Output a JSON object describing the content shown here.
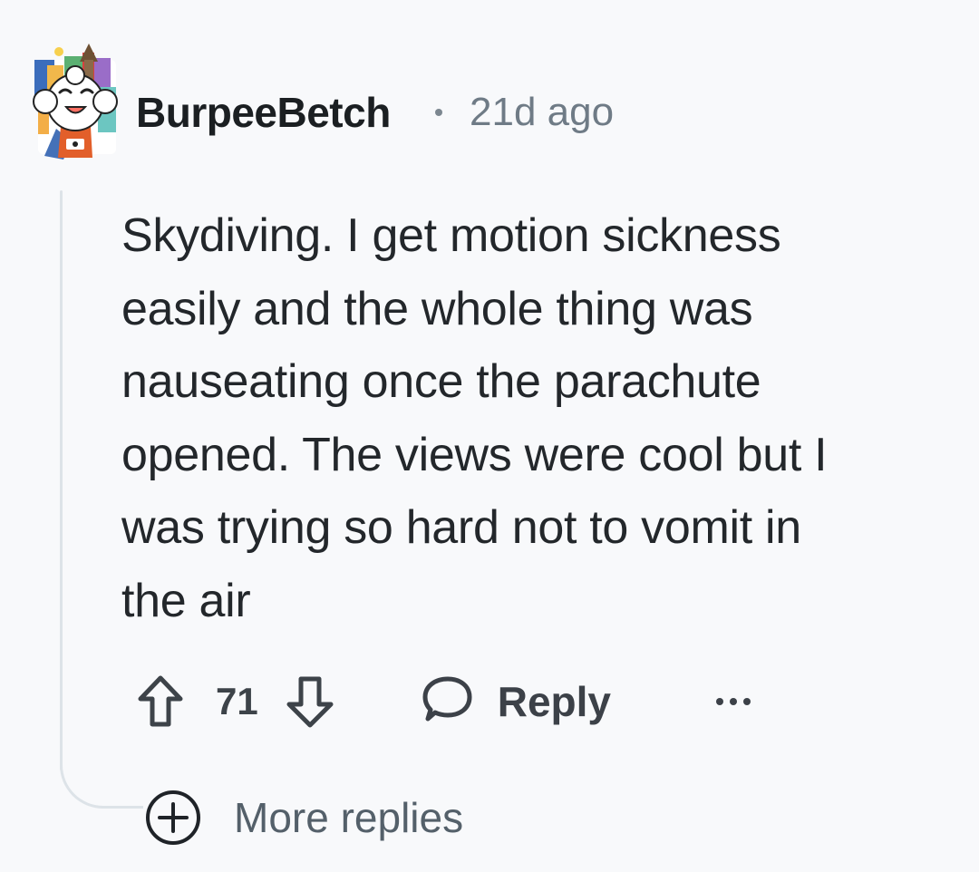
{
  "comment": {
    "author": "BurpeeBetch",
    "separator": "·",
    "time_ago": "21d ago",
    "body_lines": [
      "Skydiving. I get motion sickness",
      "easily and the whole thing was",
      "nauseating once the parachute",
      "opened. The views were cool but I",
      "was trying so hard not to vomit in",
      "the air"
    ],
    "score": "71",
    "reply_label": "Reply",
    "more_replies_label": "More replies"
  },
  "icons": {
    "avatar": "reddit-snoo-avatar",
    "upvote": "arrow-up-icon",
    "downvote": "arrow-down-icon",
    "reply": "speech-bubble-icon",
    "more": "ellipsis-icon",
    "expand": "plus-circle-icon"
  },
  "colors": {
    "background": "#f8f9fb",
    "text": "#23272b",
    "muted": "#6f7b86",
    "thread": "#dde3e8"
  }
}
